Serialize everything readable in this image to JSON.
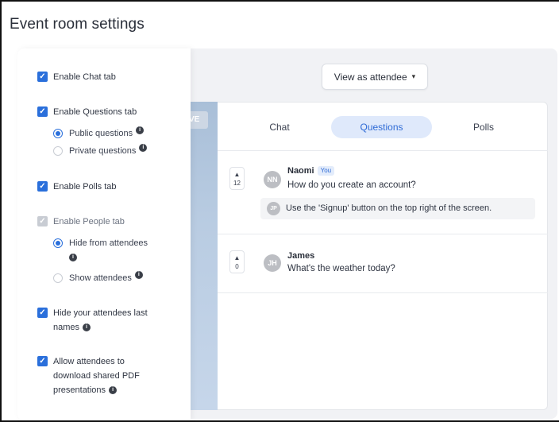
{
  "page": {
    "title": "Event room settings"
  },
  "preview": {
    "live_badge": "VE",
    "view_as_button": "View as attendee"
  },
  "settings": {
    "enable_chat": "Enable Chat tab",
    "enable_questions": "Enable Questions tab",
    "public_questions": "Public questions",
    "private_questions": "Private questions",
    "enable_polls": "Enable Polls tab",
    "enable_people": "Enable People tab",
    "hide_from_attendees": "Hide from attendees",
    "show_attendees": "Show attendees",
    "hide_last_names_line1": "Hide your attendees last",
    "hide_last_names_line2": "names",
    "allow_download_line1": "Allow attendees to",
    "allow_download_line2": "download shared PDF",
    "allow_download_line3": "presentations"
  },
  "tabs": {
    "chat": "Chat",
    "questions": "Questions",
    "polls": "Polls",
    "active": "Questions"
  },
  "questions": [
    {
      "votes": "12",
      "initials": "NN",
      "name": "Naomi",
      "badge": "You",
      "text": "How do you create an account?",
      "answer": {
        "initials": "JP",
        "text": "Use the 'Signup' button on the top right of the screen."
      }
    },
    {
      "votes": "0",
      "initials": "JH",
      "name": "James",
      "text": "What's the weather today?"
    }
  ],
  "colors": {
    "accent": "#2a6fdb",
    "active_tab_bg": "#dfe9fb",
    "avatar": "#bcbec3"
  },
  "icons": {
    "check": "✓",
    "info": "i",
    "chevron": "⌄",
    "vote_up": "▲"
  }
}
